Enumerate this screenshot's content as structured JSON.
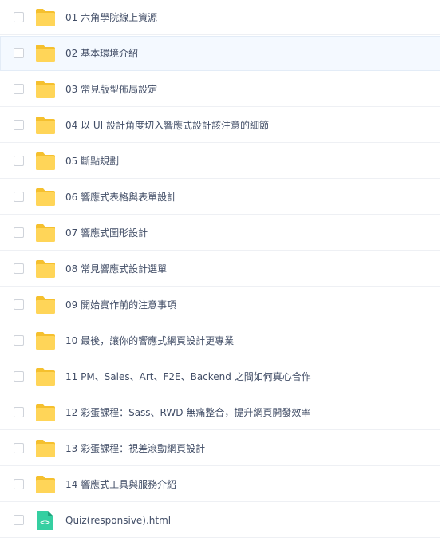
{
  "files": [
    {
      "name": "01 六角學院線上資源",
      "type": "folder"
    },
    {
      "name": "02 基本環境介紹",
      "type": "folder"
    },
    {
      "name": "03 常見版型佈局設定",
      "type": "folder"
    },
    {
      "name": "04 以 UI 設計角度切入響應式設計該注意的細節",
      "type": "folder"
    },
    {
      "name": "05 斷點規劃",
      "type": "folder"
    },
    {
      "name": "06 響應式表格與表單設計",
      "type": "folder"
    },
    {
      "name": "07 響應式圖形設計",
      "type": "folder"
    },
    {
      "name": "08 常見響應式設計選單",
      "type": "folder"
    },
    {
      "name": "09 開始實作前的注意事項",
      "type": "folder"
    },
    {
      "name": "10 最後，讓你的響應式網頁設計更專業",
      "type": "folder"
    },
    {
      "name": "11 PM、Sales、Art、F2E、Backend 之間如何真心合作",
      "type": "folder"
    },
    {
      "name": "12 彩蛋課程：Sass、RWD 無痛整合，提升網頁開發效率",
      "type": "folder"
    },
    {
      "name": "13 彩蛋課程：視差滾動網頁設計",
      "type": "folder"
    },
    {
      "name": "14 響應式工具與服務介紹",
      "type": "folder"
    },
    {
      "name": "Quiz(responsive).html",
      "type": "html"
    }
  ],
  "highlighted_index": 1,
  "icons": {
    "folder": "folder-icon",
    "html": "html-file-icon"
  },
  "colors": {
    "folder_fill": "#ffd558",
    "folder_tab": "#f5c02e",
    "html_fill": "#35cfa1",
    "html_fold": "#1fa57e",
    "text": "#424e67",
    "highlight_bg": "#f4f9ff",
    "divider": "#eef0f4"
  }
}
